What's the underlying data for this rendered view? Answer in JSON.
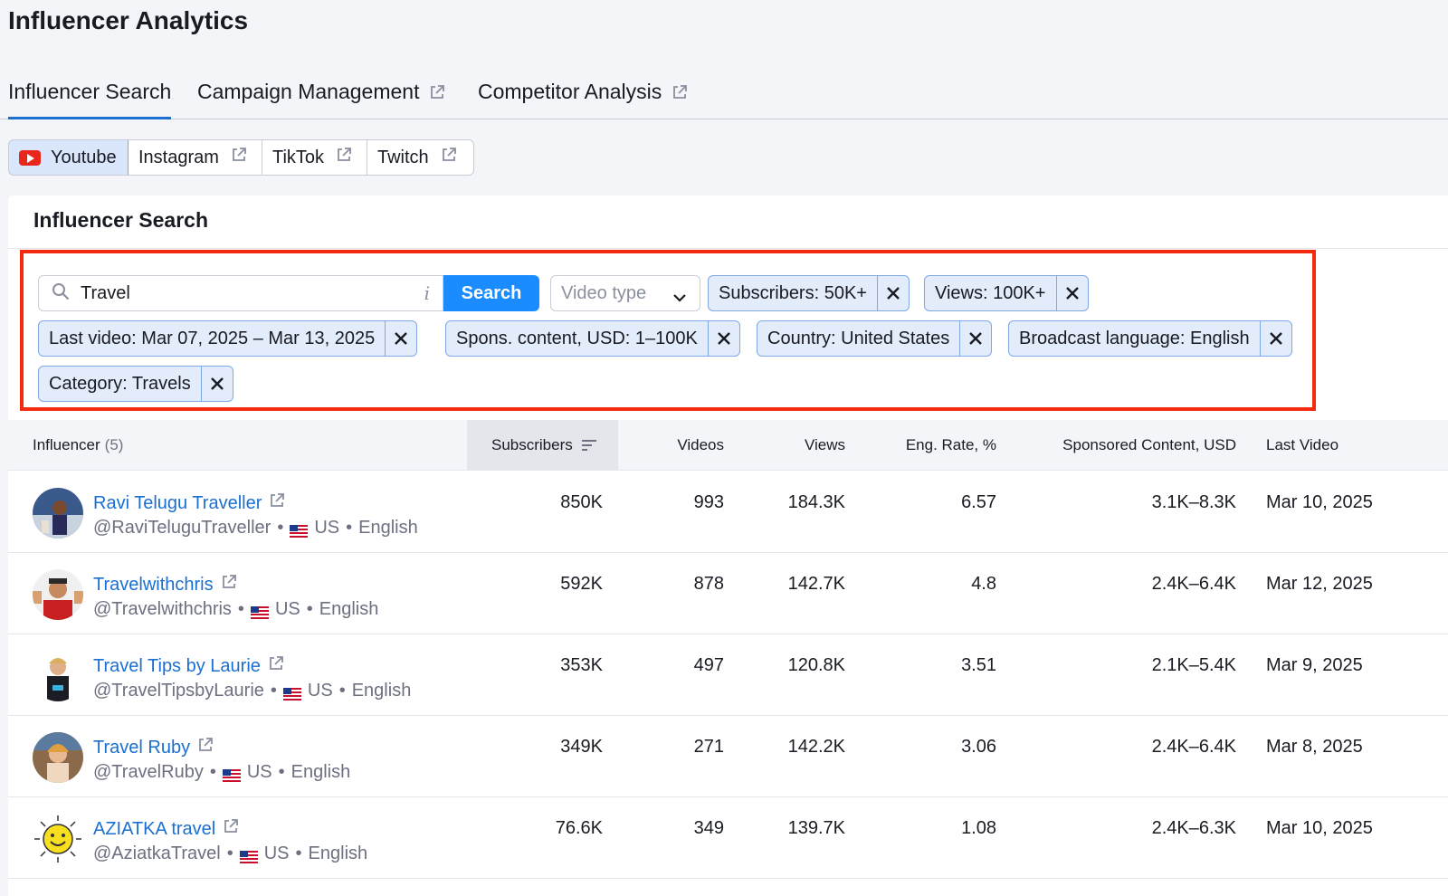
{
  "app": {
    "title": "Influencer Analytics"
  },
  "top_tabs": [
    {
      "label": "Influencer Search",
      "active": true,
      "external": false
    },
    {
      "label": "Campaign Management",
      "active": false,
      "external": true
    },
    {
      "label": "Competitor Analysis",
      "active": false,
      "external": true
    }
  ],
  "platform_tabs": [
    {
      "label": "Youtube",
      "active": true,
      "icon": "youtube-icon"
    },
    {
      "label": "Instagram",
      "active": false,
      "icon": "external-link-icon"
    },
    {
      "label": "TikTok",
      "active": false,
      "icon": "external-link-icon"
    },
    {
      "label": "Twitch",
      "active": false,
      "icon": "external-link-icon"
    }
  ],
  "card": {
    "title": "Influencer Search"
  },
  "search": {
    "value": "Travel",
    "button_label": "Search",
    "info_glyph": "i"
  },
  "video_type": {
    "placeholder": "Video type"
  },
  "filters": [
    "Subscribers: 50K+",
    "Views: 100K+",
    "Last video: Mar 07, 2025 – Mar 13, 2025",
    "Spons. content, USD: 1–100K",
    "Country: United States",
    "Broadcast language: English",
    "Category: Travels"
  ],
  "table": {
    "headers": {
      "influencer": "Influencer",
      "influencer_count": "(5)",
      "subscribers": "Subscribers",
      "videos": "Videos",
      "views": "Views",
      "eng_rate": "Eng. Rate, %",
      "sponsored": "Sponsored Content, USD",
      "last_video": "Last Video"
    },
    "rows": [
      {
        "name": "Ravi Telugu Traveller",
        "handle": "@RaviTeluguTraveller",
        "country": "US",
        "language": "English",
        "subscribers": "850K",
        "videos": "993",
        "views": "184.3K",
        "eng_rate": "6.57",
        "sponsored": "3.1K–8.3K",
        "last_video": "Mar 10, 2025"
      },
      {
        "name": "Travelwithchris",
        "handle": "@Travelwithchris",
        "country": "US",
        "language": "English",
        "subscribers": "592K",
        "videos": "878",
        "views": "142.7K",
        "eng_rate": "4.8",
        "sponsored": "2.4K–6.4K",
        "last_video": "Mar 12, 2025"
      },
      {
        "name": "Travel Tips by Laurie",
        "handle": "@TravelTipsbyLaurie",
        "country": "US",
        "language": "English",
        "subscribers": "353K",
        "videos": "497",
        "views": "120.8K",
        "eng_rate": "3.51",
        "sponsored": "2.1K–5.4K",
        "last_video": "Mar 9, 2025"
      },
      {
        "name": "Travel Ruby",
        "handle": "@TravelRuby",
        "country": "US",
        "language": "English",
        "subscribers": "349K",
        "videos": "271",
        "views": "142.2K",
        "eng_rate": "3.06",
        "sponsored": "2.4K–6.4K",
        "last_video": "Mar 8, 2025"
      },
      {
        "name": "AZIATKA travel",
        "handle": "@AziatkaTravel",
        "country": "US",
        "language": "English",
        "subscribers": "76.6K",
        "videos": "349",
        "views": "139.7K",
        "eng_rate": "1.08",
        "sponsored": "2.4K–6.3K",
        "last_video": "Mar 10, 2025"
      }
    ]
  },
  "colors": {
    "accent": "#1a8cff",
    "link": "#1a6fd1",
    "highlight_frame": "#f22a10",
    "chip_bg": "#e3ecfb"
  }
}
